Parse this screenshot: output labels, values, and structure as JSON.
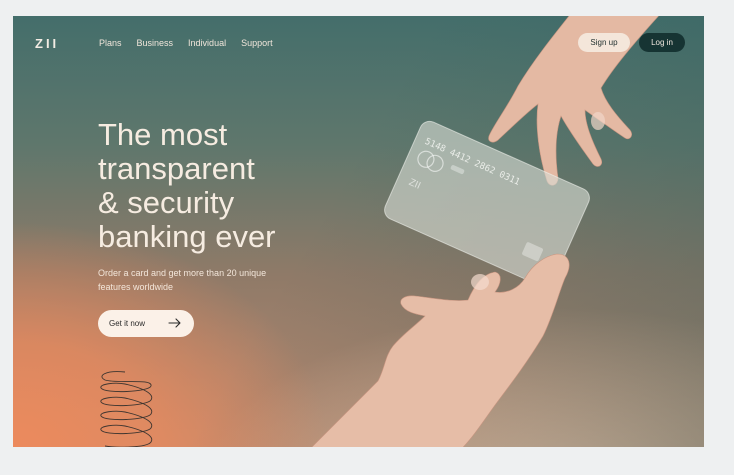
{
  "brand": {
    "logo": "ZII"
  },
  "nav": {
    "items": [
      "Plans",
      "Business",
      "Individual",
      "Support"
    ]
  },
  "header": {
    "signup_label": "Sign up",
    "login_label": "Log in"
  },
  "hero": {
    "headline_lines": [
      "The most",
      "transparent",
      "& security",
      "banking ever"
    ],
    "subtext": "Order a card and get more than 20 unique features worldwide",
    "cta_label": "Get it now"
  },
  "card": {
    "number": "5148 4412 2862 0311",
    "brand": "ZII"
  },
  "colors": {
    "dark_teal": "#163433",
    "cream": "#f4e6da",
    "orange": "#ec8a5d",
    "teal_top": "#446e6b"
  }
}
